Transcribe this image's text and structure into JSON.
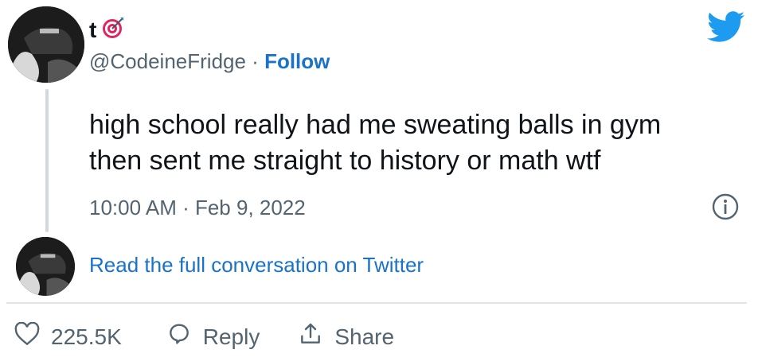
{
  "author": {
    "display_name": "t",
    "handle": "@CodeineFridge",
    "separator": " · ",
    "follow_label": "Follow",
    "badge_icon": "bullseye-icon"
  },
  "tweet": {
    "lines": [
      "high school really had me sweating balls in gym",
      "then sent me straight to history or math wtf"
    ],
    "timestamp": "10:00 AM · Feb 9, 2022"
  },
  "conversation_link": "Read the full conversation on Twitter",
  "actions": {
    "like_count": "225.5K",
    "reply_label": "Reply",
    "share_label": "Share"
  },
  "colors": {
    "twitter_blue": "#1d9bf0",
    "link_blue": "#1a73c8",
    "secondary_text": "#536471"
  }
}
